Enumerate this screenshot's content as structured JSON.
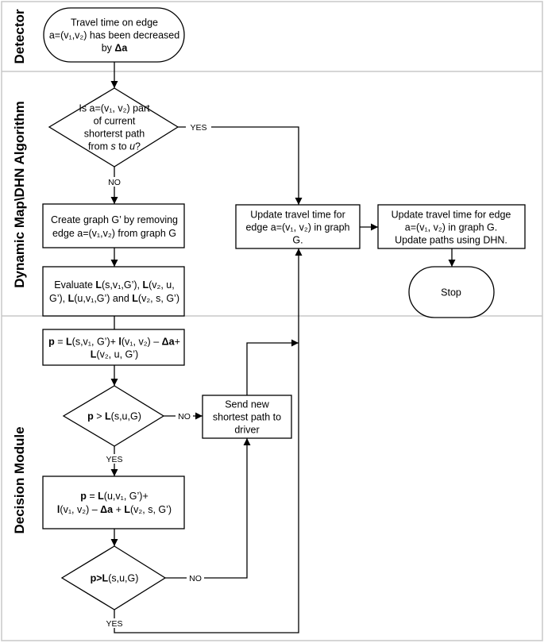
{
  "lanes": [
    {
      "label": "Detector"
    },
    {
      "label": "Dynamic Map\\DHN Algorithm"
    },
    {
      "label": "Decision Module"
    }
  ],
  "nodes": {
    "start": [
      [
        {
          "t": "Travel time on edge"
        }
      ],
      [
        {
          "t": "a=(v₁,v₂) has been decreased"
        }
      ],
      [
        {
          "t": "by "
        },
        {
          "t": "Δa",
          "b": true
        }
      ]
    ],
    "decision1": [
      [
        {
          "t": "Is a=(v₁, v₂) part"
        }
      ],
      [
        {
          "t": "of current"
        }
      ],
      [
        {
          "t": "shorterst path"
        }
      ],
      [
        {
          "t": "from "
        },
        {
          "t": "s",
          "i": true
        },
        {
          "t": " to "
        },
        {
          "t": "u",
          "i": true
        },
        {
          "t": "?"
        }
      ]
    ],
    "create_graph": [
      [
        {
          "t": "Create graph G’ by removing"
        }
      ],
      [
        {
          "t": "edge a=(v₁,v₂) from graph G"
        }
      ]
    ],
    "evaluate": [
      [
        {
          "t": "Evaluate "
        },
        {
          "t": "L",
          "b": true
        },
        {
          "t": "(s,v₁,G’), "
        },
        {
          "t": "L",
          "b": true
        },
        {
          "t": "(v₂, u,"
        }
      ],
      [
        {
          "t": "G’), "
        },
        {
          "t": "L",
          "b": true
        },
        {
          "t": "(u,v₁,G’) and "
        },
        {
          "t": "L",
          "b": true
        },
        {
          "t": "(v₂, s, G’)"
        }
      ]
    ],
    "compute_p1": [
      [
        {
          "t": "p",
          "b": true
        },
        {
          "t": " = "
        },
        {
          "t": "L",
          "b": true
        },
        {
          "t": "(s,v₁, G’)+ "
        },
        {
          "t": "l",
          "b": true
        },
        {
          "t": "(v₁, v₂) – "
        },
        {
          "t": "Δa",
          "b": true
        },
        {
          "t": "+"
        }
      ],
      [
        {
          "t": "L",
          "b": true
        },
        {
          "t": "(v₂, u, G’)"
        }
      ]
    ],
    "decision2": [
      [
        {
          "t": "p",
          "b": true
        },
        {
          "t": " > "
        },
        {
          "t": "L",
          "b": true
        },
        {
          "t": "(s,u,G)"
        }
      ]
    ],
    "send_path": [
      [
        {
          "t": "Send new"
        }
      ],
      [
        {
          "t": "shortest path to"
        }
      ],
      [
        {
          "t": "driver"
        }
      ]
    ],
    "compute_p2": [
      [
        {
          "t": "p",
          "b": true
        },
        {
          "t": " = "
        },
        {
          "t": "L",
          "b": true
        },
        {
          "t": "(u,v₁, G’)+"
        }
      ],
      [
        {
          "t": "l",
          "b": true
        },
        {
          "t": "(v₁, v₂) – "
        },
        {
          "t": "Δa",
          "b": true
        },
        {
          "t": " + "
        },
        {
          "t": "L",
          "b": true
        },
        {
          "t": "(v₂, s, G’)"
        }
      ]
    ],
    "decision3": [
      [
        {
          "t": "p>",
          "b": true
        },
        {
          "t": "L",
          "b": true
        },
        {
          "t": "(s,u,G)"
        }
      ]
    ],
    "update1": [
      [
        {
          "t": "Update travel time for"
        }
      ],
      [
        {
          "t": "edge a=(v₁, v₂) in graph"
        }
      ],
      [
        {
          "t": "G."
        }
      ]
    ],
    "update2": [
      [
        {
          "t": "Update travel time for edge"
        }
      ],
      [
        {
          "t": "a=(v₁, v₂)  in graph G."
        }
      ],
      [
        {
          "t": "Update  paths using DHN."
        }
      ]
    ],
    "stop": [
      [
        {
          "t": "Stop"
        }
      ]
    ]
  },
  "edge_labels": {
    "d1_yes": "YES",
    "d1_no": "NO",
    "d2_no": "NO",
    "d2_yes": "YES",
    "d3_no": "NO",
    "d3_yes": "YES"
  }
}
